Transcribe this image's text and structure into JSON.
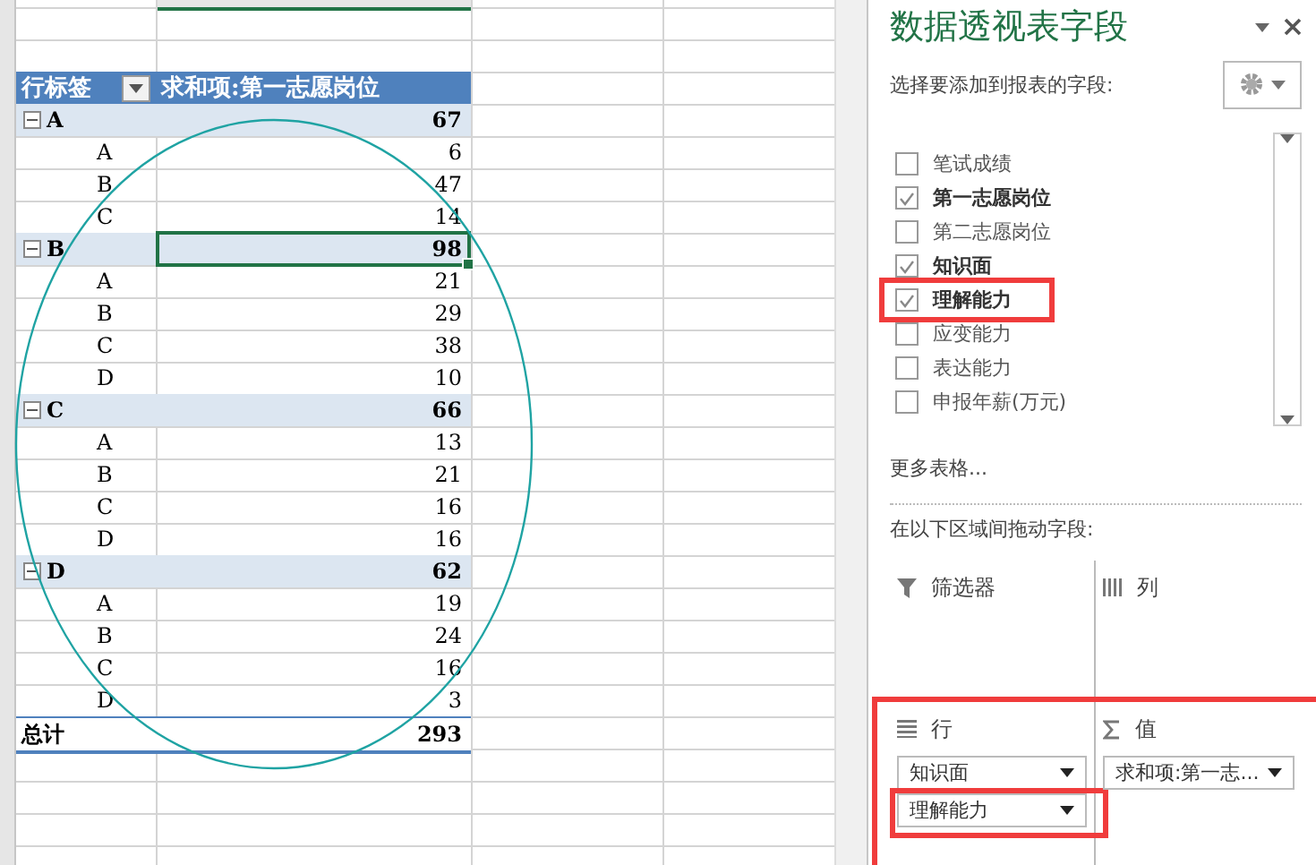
{
  "pivot": {
    "row_label": "行标签",
    "value_header": "求和项:第一志愿岗位",
    "groups": [
      {
        "label": "A",
        "value": "67",
        "expanded": true,
        "selected": false,
        "children": [
          {
            "label": "A",
            "value": "6"
          },
          {
            "label": "B",
            "value": "47"
          },
          {
            "label": "C",
            "value": "14"
          }
        ]
      },
      {
        "label": "B",
        "value": "98",
        "expanded": true,
        "selected": true,
        "children": [
          {
            "label": "A",
            "value": "21"
          },
          {
            "label": "B",
            "value": "29"
          },
          {
            "label": "C",
            "value": "38"
          },
          {
            "label": "D",
            "value": "10"
          }
        ]
      },
      {
        "label": "C",
        "value": "66",
        "expanded": true,
        "selected": false,
        "children": [
          {
            "label": "A",
            "value": "13"
          },
          {
            "label": "B",
            "value": "21"
          },
          {
            "label": "C",
            "value": "16"
          },
          {
            "label": "D",
            "value": "16"
          }
        ]
      },
      {
        "label": "D",
        "value": "62",
        "expanded": true,
        "selected": false,
        "children": [
          {
            "label": "A",
            "value": "19"
          },
          {
            "label": "B",
            "value": "24"
          },
          {
            "label": "C",
            "value": "16"
          },
          {
            "label": "D",
            "value": "3"
          }
        ]
      }
    ],
    "total_label": "总计",
    "total_value": "293"
  },
  "panel": {
    "title": "数据透视表字段",
    "subtitle": "选择要添加到报表的字段:",
    "fields": [
      {
        "label": "笔试成绩",
        "checked": false,
        "highlighted": false
      },
      {
        "label": "第一志愿岗位",
        "checked": true,
        "highlighted": false
      },
      {
        "label": "第二志愿岗位",
        "checked": false,
        "highlighted": false
      },
      {
        "label": "知识面",
        "checked": true,
        "highlighted": false
      },
      {
        "label": "理解能力",
        "checked": true,
        "highlighted": true
      },
      {
        "label": "应变能力",
        "checked": false,
        "highlighted": false
      },
      {
        "label": "表达能力",
        "checked": false,
        "highlighted": false
      },
      {
        "label": "申报年薪(万元)",
        "checked": false,
        "highlighted": false
      }
    ],
    "more_tables": "更多表格...",
    "drag_hint": "在以下区域间拖动字段:",
    "areas_highlighted": true,
    "areas": [
      {
        "kind": "filter",
        "label": "筛选器"
      },
      {
        "kind": "columns",
        "label": "列"
      },
      {
        "kind": "rows",
        "label": "行",
        "items": [
          {
            "label": "知识面",
            "highlighted": false
          },
          {
            "label": "理解能力",
            "highlighted": true
          }
        ]
      },
      {
        "kind": "values",
        "label": "值",
        "items": [
          {
            "label": "求和项:第一志...",
            "highlighted": false
          }
        ]
      }
    ]
  }
}
